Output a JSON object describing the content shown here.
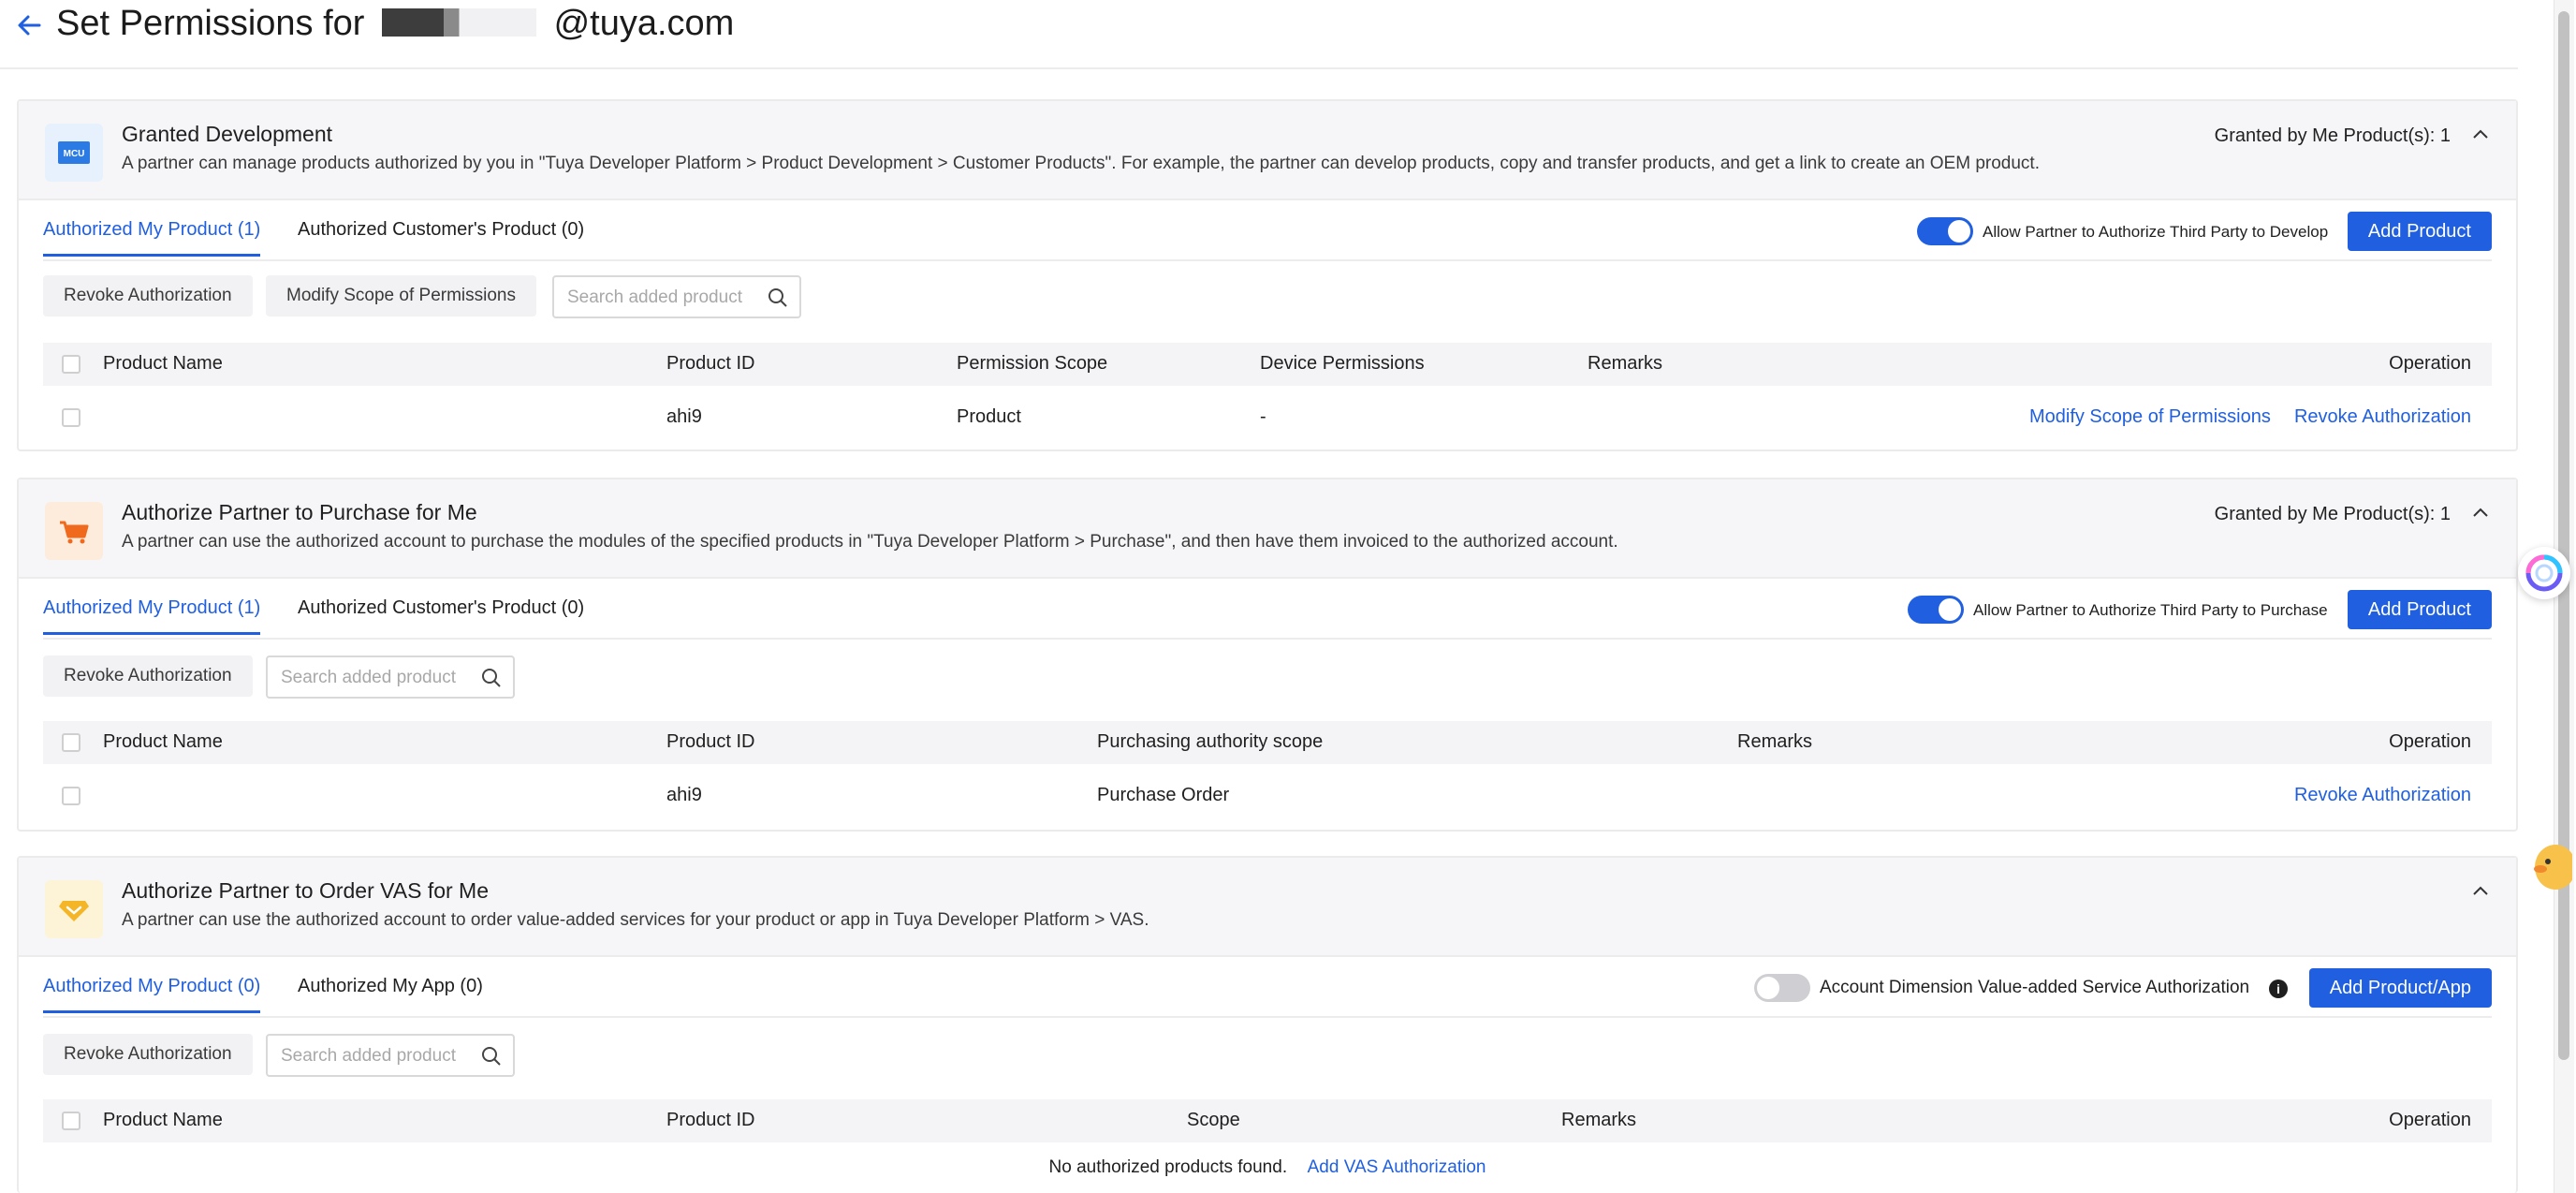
{
  "header": {
    "title_prefix": "Set Permissions for",
    "title_suffix": "@tuya.com"
  },
  "sections": [
    {
      "title": "Granted Development",
      "description": "A partner can manage products authorized by you in \"Tuya Developer Platform > Product Development > Customer Products\". For example, the partner can develop products, copy and transfer products, and get a link to create an OEM product.",
      "granted": "Granted by Me Product(s): 1",
      "icon_label": "MCU",
      "tabs": [
        "Authorized My Product (1)",
        "Authorized Customer's Product (0)"
      ],
      "toggle_label": "Allow Partner to Authorize Third Party to Develop",
      "toggle_on": true,
      "add_button": "Add Product",
      "toolbar": [
        "Revoke Authorization",
        "Modify Scope of Permissions"
      ],
      "search_placeholder": "Search added product",
      "columns": [
        "Product Name",
        "Product ID",
        "Permission Scope",
        "Device Permissions",
        "Remarks",
        "Operation"
      ],
      "rows": [
        {
          "name": "",
          "id": "ahi9",
          "scope": "Product",
          "device": "-",
          "remarks": "",
          "actions": [
            "Modify Scope of Permissions",
            "Revoke Authorization"
          ]
        }
      ]
    },
    {
      "title": "Authorize Partner to Purchase for Me",
      "description": "A partner can use the authorized account to purchase the modules of the specified products in \"Tuya Developer Platform > Purchase\", and then have them invoiced to the authorized account.",
      "granted": "Granted by Me Product(s): 1",
      "tabs": [
        "Authorized My Product (1)",
        "Authorized Customer's Product (0)"
      ],
      "toggle_label": "Allow Partner to Authorize Third Party to Purchase",
      "toggle_on": true,
      "add_button": "Add Product",
      "toolbar": [
        "Revoke Authorization"
      ],
      "search_placeholder": "Search added product",
      "columns": [
        "Product Name",
        "Product ID",
        "Purchasing authority scope",
        "Remarks",
        "Operation"
      ],
      "rows": [
        {
          "name": "",
          "id": "ahi9",
          "scope": "Purchase Order",
          "remarks": "",
          "actions": [
            "Revoke Authorization"
          ]
        }
      ]
    },
    {
      "title": "Authorize Partner to Order VAS for Me",
      "description": "A partner can use the authorized account to order value-added services for your product or app in Tuya Developer Platform > VAS.",
      "tabs": [
        "Authorized My Product (0)",
        "Authorized My App (0)"
      ],
      "toggle_label": "Account Dimension Value-added Service Authorization",
      "toggle_on": false,
      "add_button": "Add Product/App",
      "toolbar": [
        "Revoke Authorization"
      ],
      "search_placeholder": "Search added product",
      "columns": [
        "Product Name",
        "Product ID",
        "Scope",
        "Remarks",
        "Operation"
      ],
      "empty_text": "No authorized products found.",
      "empty_link": "Add VAS Authorization"
    }
  ],
  "colors": {
    "primary": "#1f5fe0",
    "section_header_bg": "#f6f6f8",
    "table_header_bg": "#f4f4f6"
  }
}
